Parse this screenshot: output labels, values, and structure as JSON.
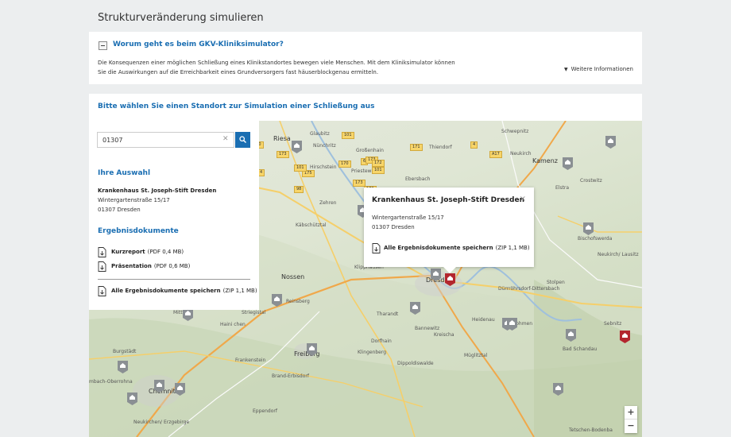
{
  "page": {
    "title": "Strukturveränderung simulieren"
  },
  "info": {
    "heading": "Worum geht es beim GKV-Kliniksimulator?",
    "text_line1": "Die Konsequenzen einer möglichen Schließung eines Klinikstandortes bewegen viele Menschen. Mit dem Kliniksimulator können",
    "text_line2": "Sie die Auswirkungen auf die Erreichbarkeit eines Grundversorgers fast häuserblockgenau ermitteln.",
    "more_label": "Weitere Informationen"
  },
  "choose": {
    "heading": "Bitte wählen Sie einen Standort zur Simulation einer Schließung aus"
  },
  "panel": {
    "search_value": "01307",
    "selection_heading": "Ihre Auswahl",
    "hospital_name": "Krankenhaus St. Joseph-Stift Dresden",
    "street": "Wintergartenstraße 15/17",
    "city": "01307 Dresden",
    "results_heading": "Ergebnisdokumente",
    "docs": [
      {
        "name": "Kurzreport",
        "meta": "(PDF 0,4 MB)"
      },
      {
        "name": "Präsentation",
        "meta": "(PDF 0,6 MB)"
      }
    ],
    "all_docs": {
      "name": "Alle Ergebnisdokumente speichern",
      "meta": "(ZIP 1,1 MB)"
    }
  },
  "popup": {
    "title": "Krankenhaus St. Joseph-Stift Dresden",
    "close": "×",
    "street": "Wintergartenstraße 15/17",
    "city": "01307 Dresden",
    "doc_name": "Alle Ergebnisdokumente speichern",
    "doc_meta": "(ZIP 1,1 MB)"
  },
  "map": {
    "labels": {
      "riesa": "Riesa",
      "glaubitz": "Glaubitz",
      "nuenchritz": "Nünchritz",
      "grossenhain": "Großenhain",
      "schwepnitz": "Schwepnitz",
      "thiendorf": "Thiendorf",
      "neukirch": "Neukirch",
      "hirschstein": "Hirschstein",
      "priestewitz": "Priestewitz",
      "ebersbach": "Ebersbach",
      "kamenz": "Kamenz",
      "crostwitz": "Crostwitz",
      "elstra": "Elstra",
      "zehren": "Zehren",
      "kaebschuetztal": "Käbschütztal",
      "bischofswerda": "Bischofswerda",
      "neukirch_lausitz": "Neukirch/ Lausitz",
      "nossen": "Nossen",
      "klipphausen": "Klipphausen",
      "dresden": "Dresden",
      "stolpen": "Stolpen",
      "duerrroehrsdorf": "Dürrröhrsdorf-Dittersbach",
      "reinsberg": "Reinsberg",
      "striegistal": "Striegistal",
      "mittweida": "Mittw",
      "haisichen": "Haini chen",
      "tharandt": "Tharandt",
      "heidenau": "Heidenau",
      "kreischa": "Kreischa",
      "freiberg": "Freiberg",
      "dorfhain": "Dorfhain",
      "burgstaedt": "Burgstädt",
      "frankenstein": "Frankenstein",
      "dippoldiswalde": "Dippoldiswalde",
      "bad_schandau": "Bad Schandau",
      "brand_erbisdorf": "Brand-Erbisdorf",
      "sebnitz": "Sebnitz",
      "chemnitz": "Chemnitz",
      "limbach": "mbach-Oberrohna",
      "eppendorf": "Eppendorf",
      "neukirchen": "Neukirchen/ Erzgebirge",
      "tetschen": "Tetschen-Bodenba",
      "klingenberg": "Klingenberg",
      "muegeln": "Müglitztal",
      "bannewitz": "Bannewitz",
      "lohmen": "Lohmen"
    },
    "roads": [
      "169",
      "101",
      "98",
      "101",
      "98",
      "4",
      "173",
      "178",
      "170",
      "4",
      "173",
      "175",
      "101",
      "14",
      "170",
      "6",
      "173",
      "172",
      "101",
      "98",
      "173",
      "173",
      "171",
      "4",
      "A17",
      "101"
    ],
    "zoom_in": "+",
    "zoom_out": "−"
  },
  "colors": {
    "accent": "#1a6eb2",
    "marker_selected": "#b3262e",
    "marker": "#8a8f93"
  }
}
